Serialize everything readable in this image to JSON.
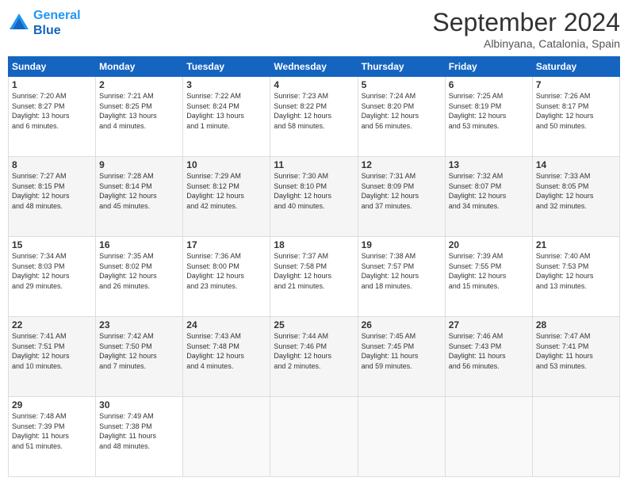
{
  "header": {
    "logo_line1": "General",
    "logo_line2": "Blue",
    "month": "September 2024",
    "location": "Albinyana, Catalonia, Spain"
  },
  "weekdays": [
    "Sunday",
    "Monday",
    "Tuesday",
    "Wednesday",
    "Thursday",
    "Friday",
    "Saturday"
  ],
  "weeks": [
    [
      {
        "day": "1",
        "info": "Sunrise: 7:20 AM\nSunset: 8:27 PM\nDaylight: 13 hours\nand 6 minutes."
      },
      {
        "day": "2",
        "info": "Sunrise: 7:21 AM\nSunset: 8:25 PM\nDaylight: 13 hours\nand 4 minutes."
      },
      {
        "day": "3",
        "info": "Sunrise: 7:22 AM\nSunset: 8:24 PM\nDaylight: 13 hours\nand 1 minute."
      },
      {
        "day": "4",
        "info": "Sunrise: 7:23 AM\nSunset: 8:22 PM\nDaylight: 12 hours\nand 58 minutes."
      },
      {
        "day": "5",
        "info": "Sunrise: 7:24 AM\nSunset: 8:20 PM\nDaylight: 12 hours\nand 56 minutes."
      },
      {
        "day": "6",
        "info": "Sunrise: 7:25 AM\nSunset: 8:19 PM\nDaylight: 12 hours\nand 53 minutes."
      },
      {
        "day": "7",
        "info": "Sunrise: 7:26 AM\nSunset: 8:17 PM\nDaylight: 12 hours\nand 50 minutes."
      }
    ],
    [
      {
        "day": "8",
        "info": "Sunrise: 7:27 AM\nSunset: 8:15 PM\nDaylight: 12 hours\nand 48 minutes."
      },
      {
        "day": "9",
        "info": "Sunrise: 7:28 AM\nSunset: 8:14 PM\nDaylight: 12 hours\nand 45 minutes."
      },
      {
        "day": "10",
        "info": "Sunrise: 7:29 AM\nSunset: 8:12 PM\nDaylight: 12 hours\nand 42 minutes."
      },
      {
        "day": "11",
        "info": "Sunrise: 7:30 AM\nSunset: 8:10 PM\nDaylight: 12 hours\nand 40 minutes."
      },
      {
        "day": "12",
        "info": "Sunrise: 7:31 AM\nSunset: 8:09 PM\nDaylight: 12 hours\nand 37 minutes."
      },
      {
        "day": "13",
        "info": "Sunrise: 7:32 AM\nSunset: 8:07 PM\nDaylight: 12 hours\nand 34 minutes."
      },
      {
        "day": "14",
        "info": "Sunrise: 7:33 AM\nSunset: 8:05 PM\nDaylight: 12 hours\nand 32 minutes."
      }
    ],
    [
      {
        "day": "15",
        "info": "Sunrise: 7:34 AM\nSunset: 8:03 PM\nDaylight: 12 hours\nand 29 minutes."
      },
      {
        "day": "16",
        "info": "Sunrise: 7:35 AM\nSunset: 8:02 PM\nDaylight: 12 hours\nand 26 minutes."
      },
      {
        "day": "17",
        "info": "Sunrise: 7:36 AM\nSunset: 8:00 PM\nDaylight: 12 hours\nand 23 minutes."
      },
      {
        "day": "18",
        "info": "Sunrise: 7:37 AM\nSunset: 7:58 PM\nDaylight: 12 hours\nand 21 minutes."
      },
      {
        "day": "19",
        "info": "Sunrise: 7:38 AM\nSunset: 7:57 PM\nDaylight: 12 hours\nand 18 minutes."
      },
      {
        "day": "20",
        "info": "Sunrise: 7:39 AM\nSunset: 7:55 PM\nDaylight: 12 hours\nand 15 minutes."
      },
      {
        "day": "21",
        "info": "Sunrise: 7:40 AM\nSunset: 7:53 PM\nDaylight: 12 hours\nand 13 minutes."
      }
    ],
    [
      {
        "day": "22",
        "info": "Sunrise: 7:41 AM\nSunset: 7:51 PM\nDaylight: 12 hours\nand 10 minutes."
      },
      {
        "day": "23",
        "info": "Sunrise: 7:42 AM\nSunset: 7:50 PM\nDaylight: 12 hours\nand 7 minutes."
      },
      {
        "day": "24",
        "info": "Sunrise: 7:43 AM\nSunset: 7:48 PM\nDaylight: 12 hours\nand 4 minutes."
      },
      {
        "day": "25",
        "info": "Sunrise: 7:44 AM\nSunset: 7:46 PM\nDaylight: 12 hours\nand 2 minutes."
      },
      {
        "day": "26",
        "info": "Sunrise: 7:45 AM\nSunset: 7:45 PM\nDaylight: 11 hours\nand 59 minutes."
      },
      {
        "day": "27",
        "info": "Sunrise: 7:46 AM\nSunset: 7:43 PM\nDaylight: 11 hours\nand 56 minutes."
      },
      {
        "day": "28",
        "info": "Sunrise: 7:47 AM\nSunset: 7:41 PM\nDaylight: 11 hours\nand 53 minutes."
      }
    ],
    [
      {
        "day": "29",
        "info": "Sunrise: 7:48 AM\nSunset: 7:39 PM\nDaylight: 11 hours\nand 51 minutes."
      },
      {
        "day": "30",
        "info": "Sunrise: 7:49 AM\nSunset: 7:38 PM\nDaylight: 11 hours\nand 48 minutes."
      },
      null,
      null,
      null,
      null,
      null
    ]
  ]
}
